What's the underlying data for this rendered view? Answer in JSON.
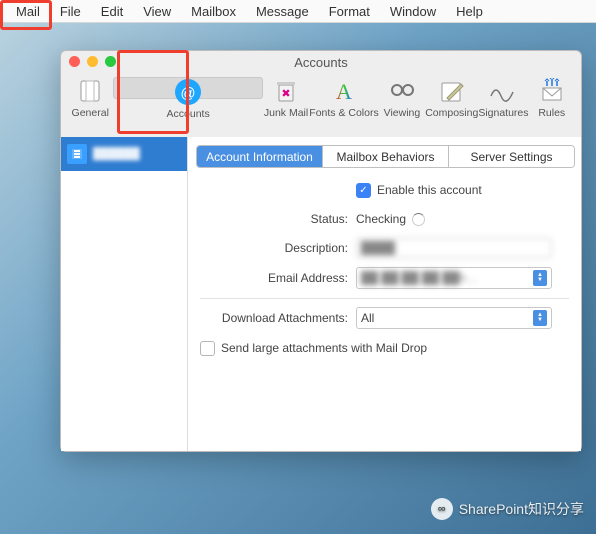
{
  "menubar": [
    "Mail",
    "File",
    "Edit",
    "View",
    "Mailbox",
    "Message",
    "Format",
    "Window",
    "Help"
  ],
  "window": {
    "title": "Accounts"
  },
  "toolbar": [
    "General",
    "Accounts",
    "Junk Mail",
    "Fonts & Colors",
    "Viewing",
    "Composing",
    "Signatures",
    "Rules"
  ],
  "sidebar": {
    "account_masked": "██████"
  },
  "tabs": [
    "Account Information",
    "Mailbox Behaviors",
    "Server Settings"
  ],
  "form": {
    "enable_label": "Enable this account",
    "enable_checked": true,
    "status_label": "Status:",
    "status_value": "Checking",
    "description_label": "Description:",
    "description_value": "████",
    "email_label": "Email Address:",
    "email_value": "██ ██ ██ ██ ██h…",
    "download_label": "Download Attachments:",
    "download_value": "All",
    "maildrop_label": "Send large attachments with Mail Drop",
    "maildrop_checked": false
  },
  "watermark": "SharePoint知识分享"
}
